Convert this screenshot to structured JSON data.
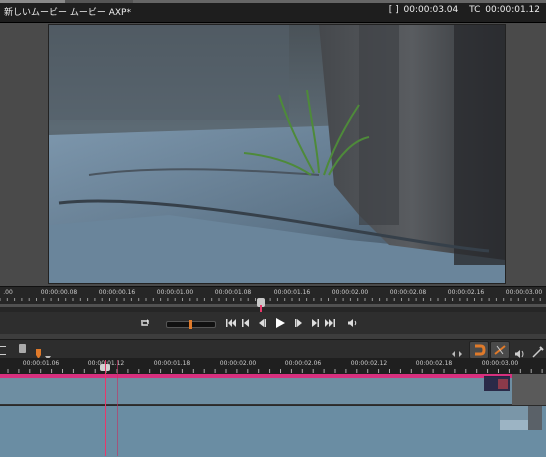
{
  "window": {
    "title": "新しいムービー ムービー AXP*",
    "bracket_icon": "in-out-bracket-icon",
    "duration": "00:00:03.04",
    "tc_label": "TC",
    "timecode": "00:00:01.12"
  },
  "preview_ruler": {
    "labels": [
      "00",
      "00:00:00.08",
      "00:00:00.16",
      "00:00:01.00",
      "00:00:01.08",
      "00:00:01.16",
      "00:00:02.00",
      "00:00:02.08",
      "00:00:02.16",
      "00:00:03.00"
    ],
    "first_label": ".00"
  },
  "transport": {
    "buttons": [
      "loop-icon",
      "go-to-start-icon",
      "previous-edit-icon",
      "step-back-icon",
      "play-icon",
      "step-forward-icon",
      "next-edit-icon",
      "go-to-end-icon",
      "volume-icon"
    ]
  },
  "timeline_ruler": {
    "labels": [
      "00:00:01.06",
      "00:00:01.12",
      "00:00:01.18",
      "00:00:02.00",
      "00:00:02.06",
      "00:00:02.12",
      "00:00:02.18",
      "00:00:03.00"
    ]
  },
  "timeline_toolbar": {
    "left_icons": [
      "menu-icon",
      "trash-icon",
      "marker-icon",
      "dropdown-icon"
    ],
    "right_icons": [
      "sync-arrows-icon",
      "magnet-icon",
      "snap-icon",
      "audio-scrub-icon",
      "razor-icon"
    ]
  },
  "colors": {
    "accent": "#e07a2a",
    "playhead": "#e8386a",
    "clip_track": "#6e8ea2",
    "marker_bar": "#d6307e"
  }
}
